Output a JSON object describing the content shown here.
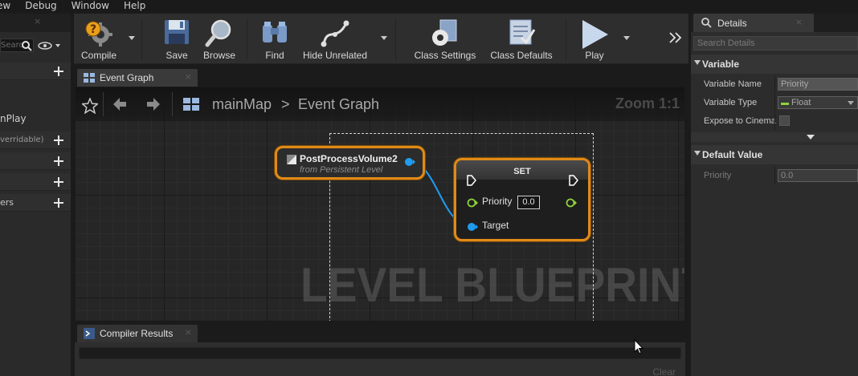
{
  "menu": {
    "items": [
      "ew",
      "Debug",
      "Window",
      "Help"
    ]
  },
  "left_panel": {
    "search_placeholder": "Searc",
    "begin_play": "nPlay",
    "rows": [
      "",
      "verridable)",
      "",
      "",
      "ers"
    ]
  },
  "toolbar": {
    "compile": "Compile",
    "save": "Save",
    "browse": "Browse",
    "find": "Find",
    "hide_unrelated": "Hide Unrelated",
    "class_settings": "Class Settings",
    "class_defaults": "Class Defaults",
    "play": "Play"
  },
  "graph_tab": {
    "label": "Event Graph"
  },
  "graph": {
    "breadcrumb_map": "mainMap",
    "breadcrumb_separator": ">",
    "breadcrumb_graph": "Event Graph",
    "zoom": "Zoom 1:1",
    "watermark": "LEVEL BLUEPRINT",
    "nodes": {
      "ppv": {
        "title": "PostProcessVolume2",
        "subtitle": "from Persistent Level"
      },
      "set": {
        "title": "SET",
        "priority_label": "Priority",
        "priority_value": "0.0",
        "target_label": "Target"
      }
    }
  },
  "compiler": {
    "tab_label": "Compiler Results",
    "clear": "Clear"
  },
  "details": {
    "tab_label": "Details",
    "search_placeholder": "Search Details",
    "variable": {
      "header": "Variable",
      "name_label": "Variable Name",
      "name_value": "Priority",
      "type_label": "Variable Type",
      "type_value": "Float",
      "expose_label": "Expose to Cinematics"
    },
    "default_value": {
      "header": "Default Value",
      "priority_label": "Priority",
      "priority_value": "0.0"
    }
  },
  "colors": {
    "node_border": "#e08a18",
    "exec_pin": "#ffffff",
    "object_pin": "#1e9cf0",
    "float_pin": "#8ed13a"
  }
}
